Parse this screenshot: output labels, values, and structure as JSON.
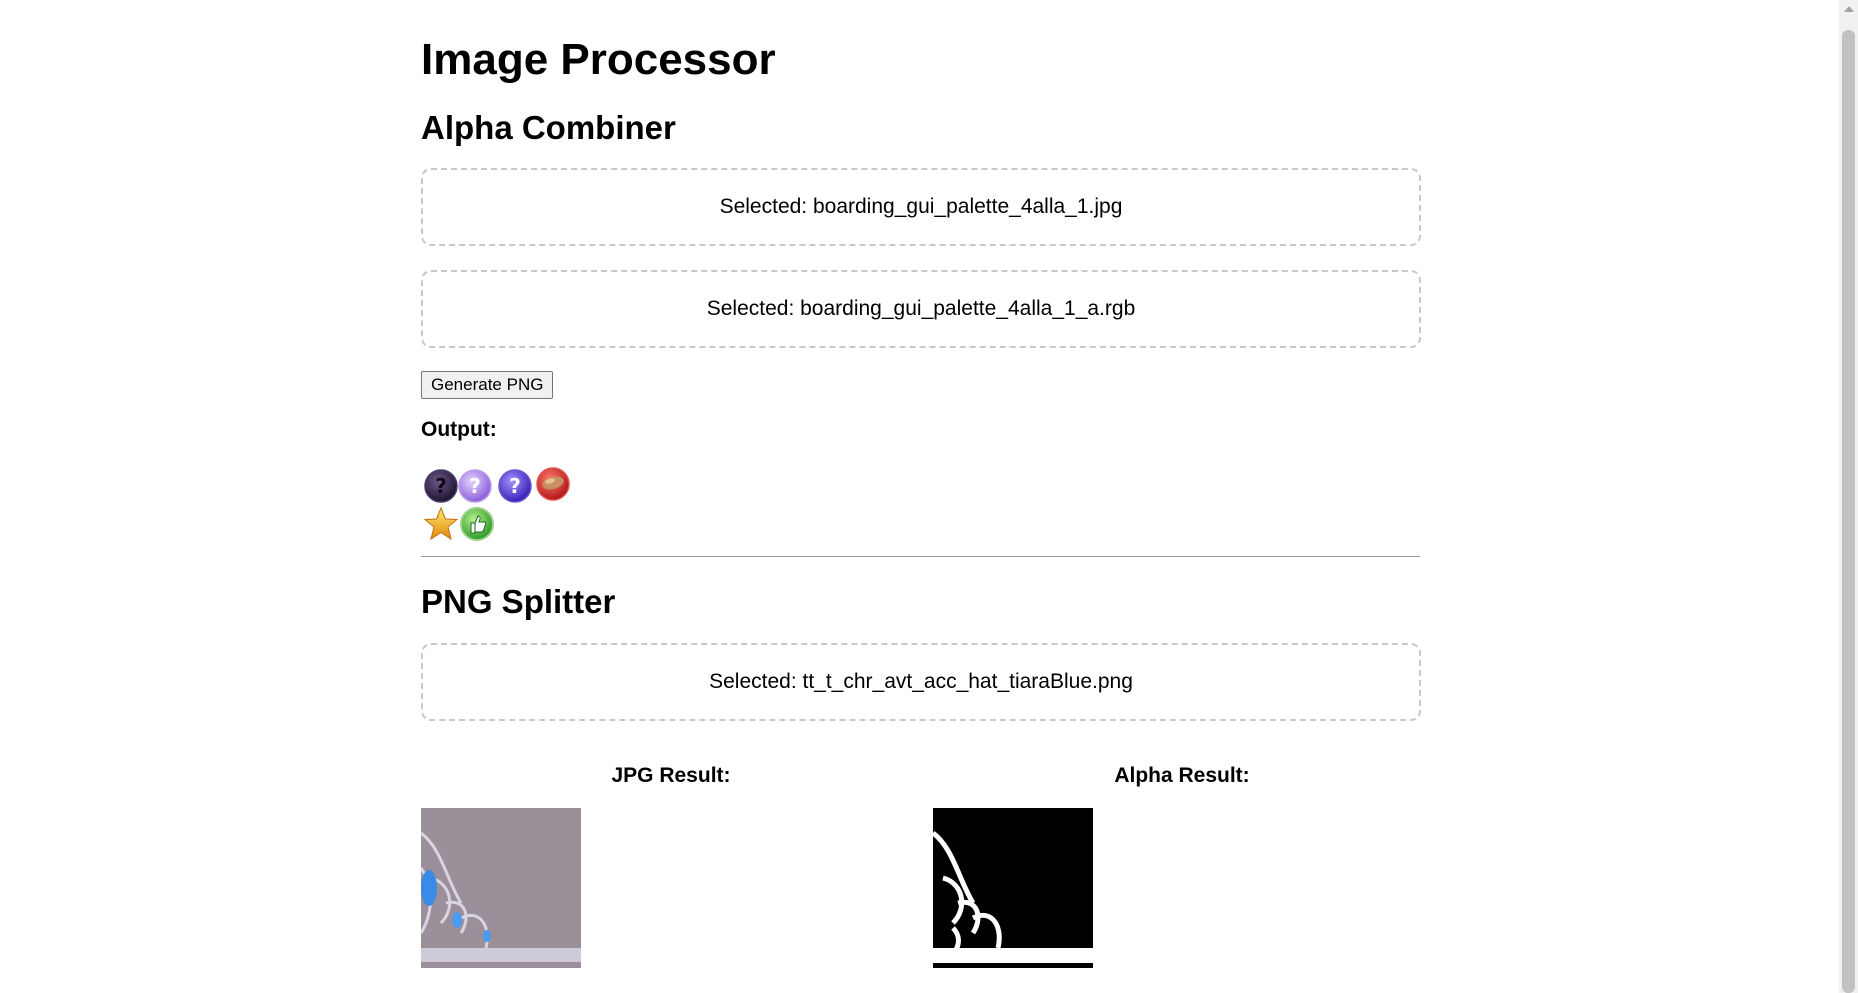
{
  "page": {
    "title": "Image Processor"
  },
  "combiner": {
    "heading": "Alpha Combiner",
    "file1": "Selected: boarding_gui_palette_4alla_1.jpg",
    "file2": "Selected: boarding_gui_palette_4alla_1_a.rgb",
    "button": "Generate PNG",
    "output_label": "Output:",
    "output_icons": [
      "dark-question-icon",
      "lavender-question-icon",
      "purple-question-icon",
      "red-shoe-icon",
      "gold-star-icon",
      "green-thumbs-up-icon"
    ]
  },
  "splitter": {
    "heading": "PNG Splitter",
    "file": "Selected: tt_t_chr_avt_acc_hat_tiaraBlue.png",
    "jpg_label": "JPG Result:",
    "alpha_label": "Alpha Result:"
  },
  "colors": {
    "dropzone_border": "#c8c8c8",
    "jpg_background": "#9b8f9a",
    "alpha_background": "#000000"
  }
}
